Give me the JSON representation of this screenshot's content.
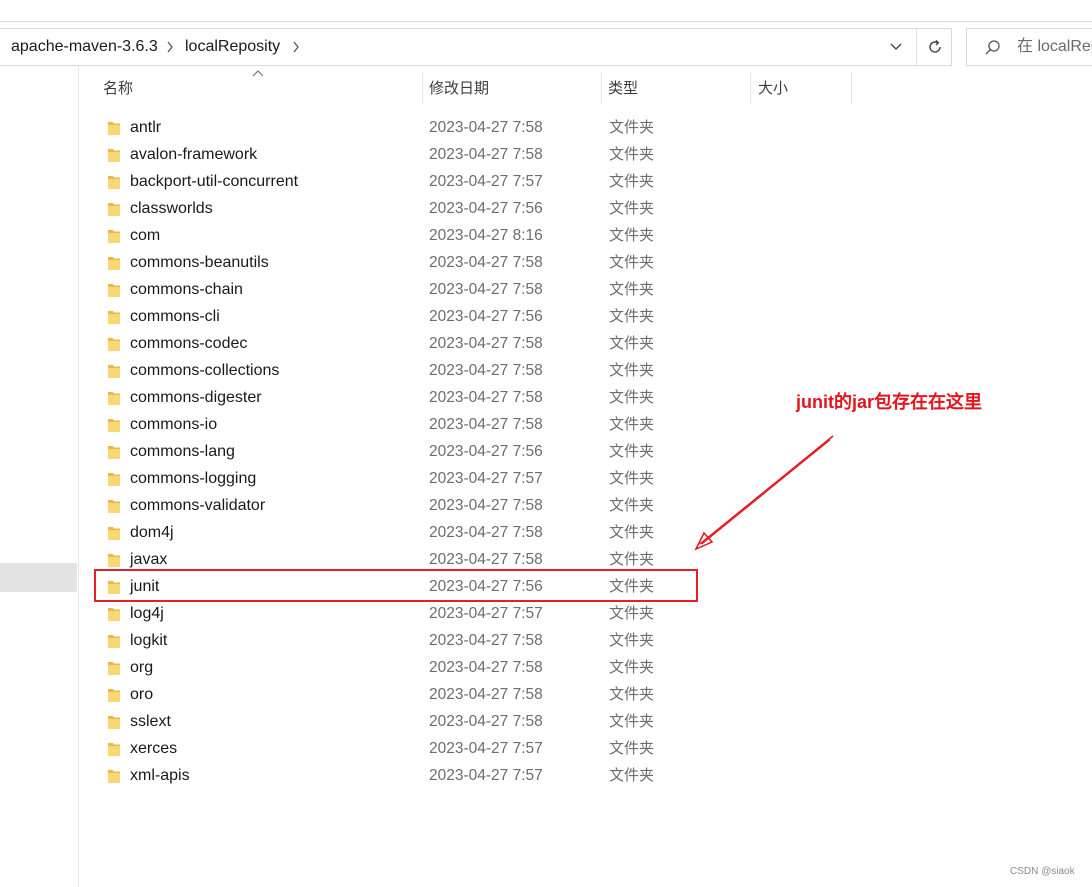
{
  "breadcrumb": {
    "items": [
      "apache-maven-3.6.3",
      "localReposity"
    ]
  },
  "search": {
    "placeholder": "在 localRepository 中搜索"
  },
  "columns": {
    "name": "名称",
    "modified": "修改日期",
    "type": "类型",
    "size": "大小"
  },
  "files": [
    {
      "name": "antlr",
      "date": "2023-04-27 7:58",
      "type": "文件夹"
    },
    {
      "name": "avalon-framework",
      "date": "2023-04-27 7:58",
      "type": "文件夹"
    },
    {
      "name": "backport-util-concurrent",
      "date": "2023-04-27 7:57",
      "type": "文件夹"
    },
    {
      "name": "classworlds",
      "date": "2023-04-27 7:56",
      "type": "文件夹"
    },
    {
      "name": "com",
      "date": "2023-04-27 8:16",
      "type": "文件夹"
    },
    {
      "name": "commons-beanutils",
      "date": "2023-04-27 7:58",
      "type": "文件夹"
    },
    {
      "name": "commons-chain",
      "date": "2023-04-27 7:58",
      "type": "文件夹"
    },
    {
      "name": "commons-cli",
      "date": "2023-04-27 7:56",
      "type": "文件夹"
    },
    {
      "name": "commons-codec",
      "date": "2023-04-27 7:58",
      "type": "文件夹"
    },
    {
      "name": "commons-collections",
      "date": "2023-04-27 7:58",
      "type": "文件夹"
    },
    {
      "name": "commons-digester",
      "date": "2023-04-27 7:58",
      "type": "文件夹"
    },
    {
      "name": "commons-io",
      "date": "2023-04-27 7:58",
      "type": "文件夹"
    },
    {
      "name": "commons-lang",
      "date": "2023-04-27 7:56",
      "type": "文件夹"
    },
    {
      "name": "commons-logging",
      "date": "2023-04-27 7:57",
      "type": "文件夹"
    },
    {
      "name": "commons-validator",
      "date": "2023-04-27 7:58",
      "type": "文件夹"
    },
    {
      "name": "dom4j",
      "date": "2023-04-27 7:58",
      "type": "文件夹"
    },
    {
      "name": "javax",
      "date": "2023-04-27 7:58",
      "type": "文件夹"
    },
    {
      "name": "junit",
      "date": "2023-04-27 7:56",
      "type": "文件夹"
    },
    {
      "name": "log4j",
      "date": "2023-04-27 7:57",
      "type": "文件夹"
    },
    {
      "name": "logkit",
      "date": "2023-04-27 7:58",
      "type": "文件夹"
    },
    {
      "name": "org",
      "date": "2023-04-27 7:58",
      "type": "文件夹"
    },
    {
      "name": "oro",
      "date": "2023-04-27 7:58",
      "type": "文件夹"
    },
    {
      "name": "sslext",
      "date": "2023-04-27 7:58",
      "type": "文件夹"
    },
    {
      "name": "xerces",
      "date": "2023-04-27 7:57",
      "type": "文件夹"
    },
    {
      "name": "xml-apis",
      "date": "2023-04-27 7:57",
      "type": "文件夹"
    }
  ],
  "annotation": {
    "text": "junit的jar包存在在这里",
    "color": "#e3151d"
  },
  "watermark": "CSDN @siaok",
  "icons": {
    "folder": "folder-icon",
    "breadcrumb_separator": "chevron-right-icon",
    "dropdown": "chevron-down-icon",
    "refresh": "refresh-icon",
    "search": "search-icon",
    "sort": "sort-up-icon"
  }
}
